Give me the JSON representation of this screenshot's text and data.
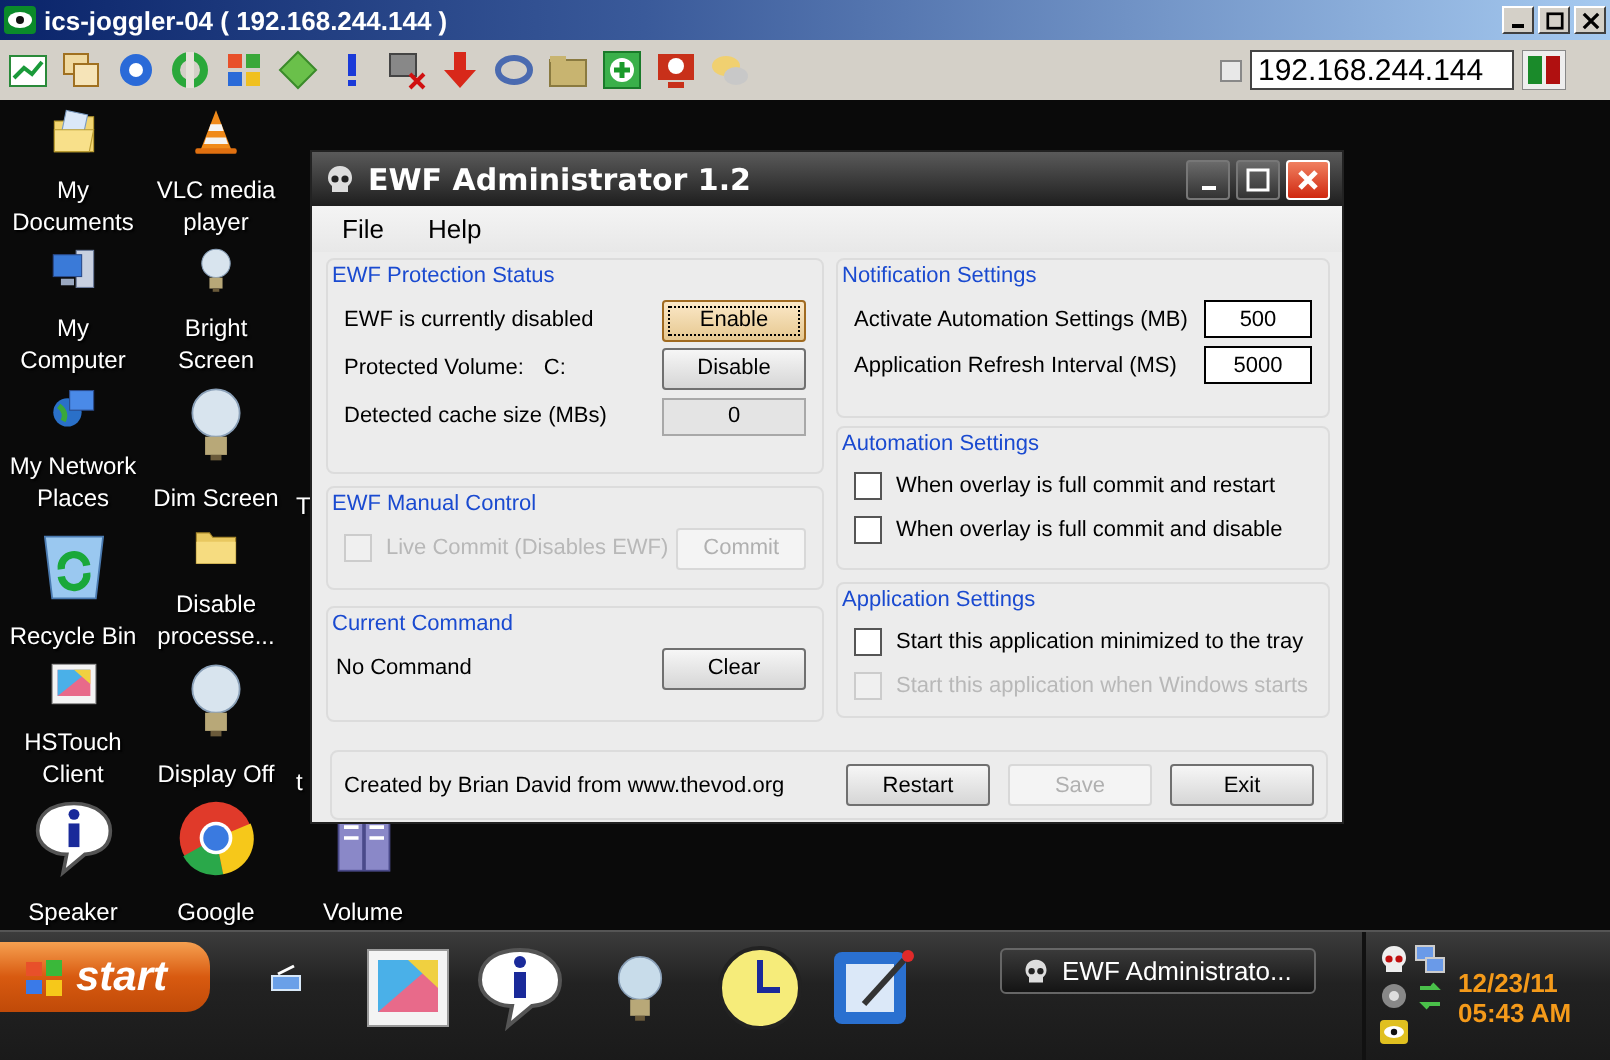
{
  "viewer": {
    "title": "ics-joggler-04 ( 192.168.244.144 )",
    "address": "192.168.244.144",
    "option_checked": false
  },
  "desktop_columns": [
    [
      {
        "label": "My Documents",
        "kind": "documents"
      },
      {
        "label": "My Computer",
        "kind": "computer"
      },
      {
        "label": "My Network Places",
        "kind": "network"
      },
      {
        "label": "Recycle Bin",
        "kind": "recycle"
      },
      {
        "label": "HSTouch Client",
        "kind": "frame"
      },
      {
        "label": "Speaker",
        "kind": "info"
      }
    ],
    [
      {
        "label": "VLC media player",
        "kind": "cone"
      },
      {
        "label": "Bright Screen",
        "kind": "bulb"
      },
      {
        "label": "Dim Screen",
        "kind": "bulb"
      },
      {
        "label": "Disable processe...",
        "kind": "folder"
      },
      {
        "label": "Display Off",
        "kind": "bulb"
      },
      {
        "label": "Google",
        "kind": "browser"
      }
    ],
    [
      {
        "label": "T",
        "kind": "covered"
      },
      {
        "label": "t",
        "kind": "covered"
      },
      {
        "label": "Volume",
        "kind": "book"
      }
    ]
  ],
  "dialog": {
    "title": "EWF Administrator 1.2",
    "menu": [
      "File",
      "Help"
    ],
    "protection": {
      "title": "EWF Protection Status",
      "status": "EWF is currently disabled",
      "enable_button": {
        "label": "Enable",
        "focused": true
      },
      "volume_label": "Protected Volume:",
      "volume": "C:",
      "disable_button": "Disable",
      "cache_label": "Detected cache size (MBs)",
      "cache_size": "0"
    },
    "manual": {
      "title": "EWF Manual Control",
      "live_commit": {
        "label": "Live Commit (Disables EWF)",
        "checked": false,
        "disabled": true
      },
      "commit_button": {
        "label": "Commit",
        "disabled": true
      }
    },
    "current": {
      "title": "Current Command",
      "command": "No Command",
      "clear_button": "Clear"
    },
    "notification": {
      "title": "Notification Settings",
      "fields": [
        {
          "label": "Activate Automation Settings (MB)",
          "value": "500"
        },
        {
          "label": "Application Refresh Interval (MS)",
          "value": "5000"
        }
      ]
    },
    "automation": {
      "title": "Automation Settings",
      "options": [
        {
          "label": "When overlay is full commit and restart",
          "checked": false,
          "disabled": false
        },
        {
          "label": "When overlay is full commit and disable",
          "checked": false,
          "disabled": false
        }
      ]
    },
    "application": {
      "title": "Application Settings",
      "options": [
        {
          "label": "Start this application minimized to the tray",
          "checked": false,
          "disabled": false
        },
        {
          "label": "Start this application when Windows starts",
          "checked": false,
          "disabled": true
        }
      ]
    },
    "footer": {
      "credit": "Created by Brian David from www.thevod.org",
      "buttons": [
        {
          "label": "Restart",
          "disabled": false
        },
        {
          "label": "Save",
          "disabled": true
        },
        {
          "label": "Exit",
          "disabled": false
        }
      ]
    }
  },
  "taskbar": {
    "start": "start",
    "tasks": [
      {
        "label": "EWF Administrato...",
        "selected": false
      }
    ],
    "clock": {
      "date": "12/23/11",
      "time": "05:43 AM"
    }
  }
}
